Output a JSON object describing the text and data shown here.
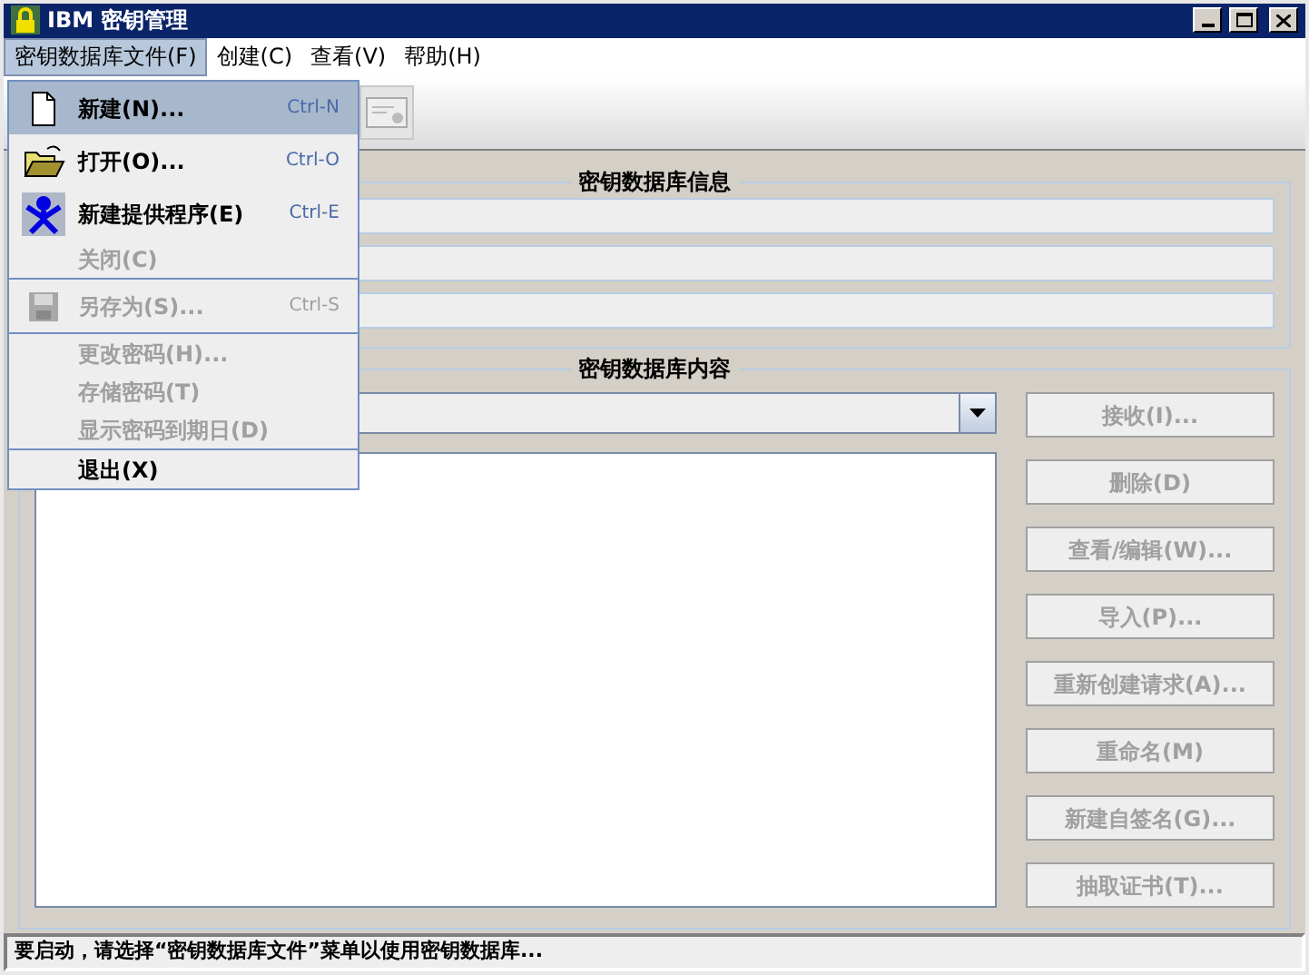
{
  "window": {
    "title": "IBM 密钥管理"
  },
  "menubar": [
    {
      "label": "密钥数据库文件(F)",
      "selected": true
    },
    {
      "label": "创建(C)",
      "selected": false
    },
    {
      "label": "查看(V)",
      "selected": false
    },
    {
      "label": "帮助(H)",
      "selected": false
    }
  ],
  "menu": {
    "groups": [
      [
        {
          "label": "新建(N)...",
          "shortcut": "Ctrl-N",
          "kind": "document",
          "disabled": false,
          "selected": true
        },
        {
          "label": "打开(O)...",
          "shortcut": "Ctrl-O",
          "kind": "folder",
          "disabled": false,
          "selected": false
        },
        {
          "label": "新建提供程序(E)",
          "shortcut": "Ctrl-E",
          "kind": "provider",
          "disabled": false,
          "selected": false
        },
        {
          "label": "关闭(C)",
          "kind": "plain",
          "disabled": true,
          "selected": false
        }
      ],
      [
        {
          "label": "另存为(S)...",
          "shortcut": "Ctrl-S",
          "kind": "save",
          "disabled": true,
          "selected": false
        }
      ],
      [
        {
          "label": "更改密码(H)...",
          "kind": "plain",
          "disabled": true,
          "selected": false
        },
        {
          "label": "存储密码(T)",
          "kind": "plain",
          "disabled": true,
          "selected": false
        },
        {
          "label": "显示密码到期日(D)",
          "kind": "plain",
          "disabled": true,
          "selected": false
        }
      ],
      [
        {
          "label": "退出(X)",
          "kind": "plain",
          "disabled": false,
          "selected": false
        }
      ]
    ]
  },
  "info_panel": {
    "title": "密钥数据库信息"
  },
  "content_panel": {
    "title": "密钥数据库内容",
    "buttons": [
      {
        "label": "接收(I)...",
        "disabled": true
      },
      {
        "label": "删除(D)",
        "disabled": true
      },
      {
        "label": "查看/编辑(W)...",
        "disabled": true
      },
      {
        "label": "导入(P)...",
        "disabled": true
      },
      {
        "label": "重新创建请求(A)...",
        "disabled": true
      },
      {
        "label": "重命名(M)",
        "disabled": true
      },
      {
        "label": "新建自签名(G)...",
        "disabled": true
      },
      {
        "label": "抽取证书(T)...",
        "disabled": true
      }
    ]
  },
  "status_bar": "要启动，请选择“密钥数据库文件”菜单以使用密钥数据库..."
}
